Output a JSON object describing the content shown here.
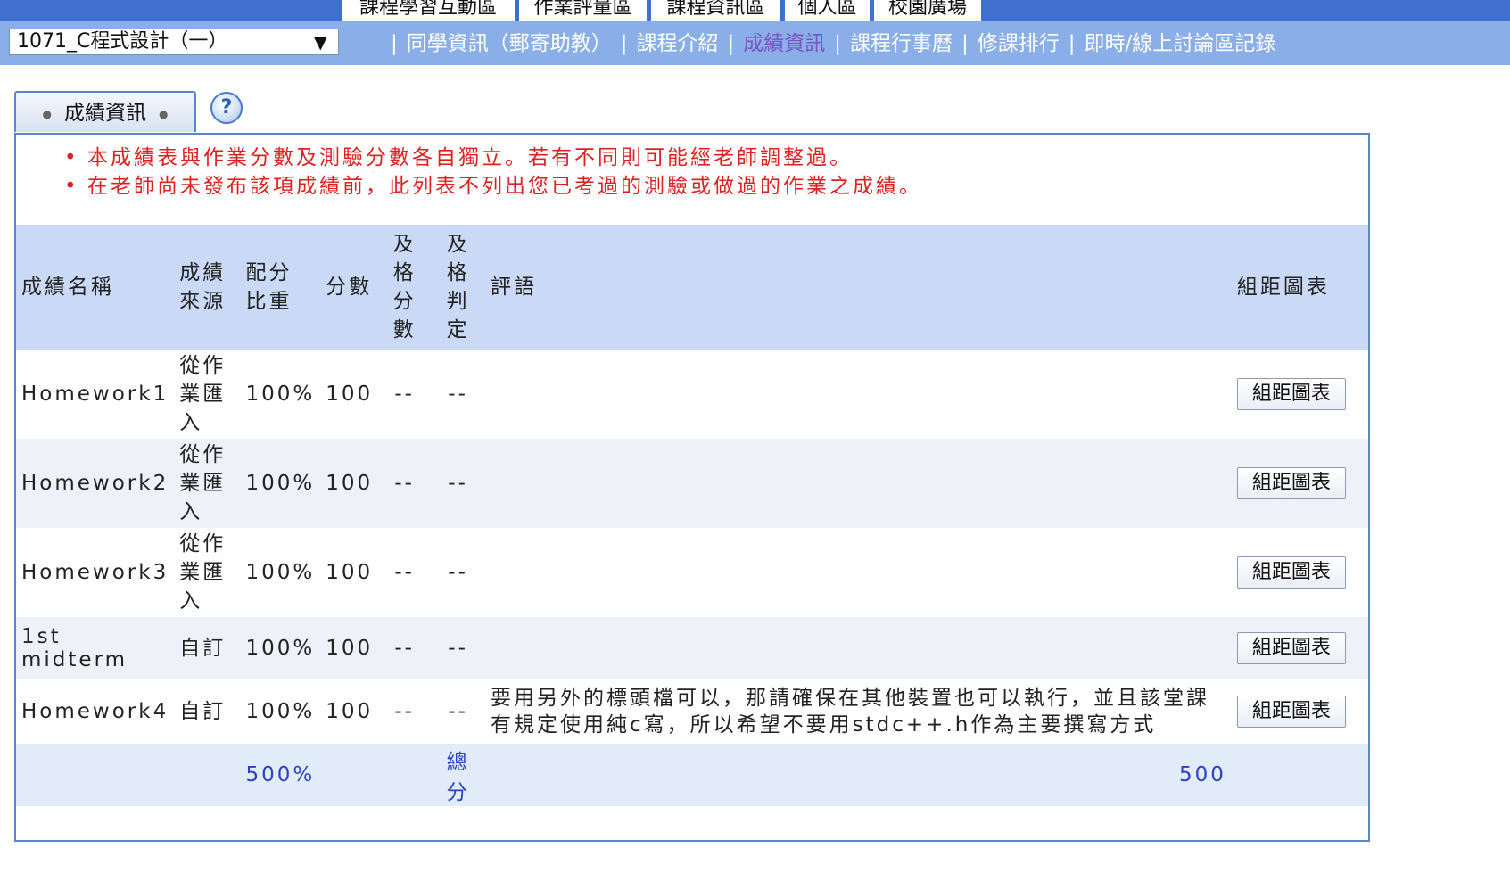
{
  "top_tabs": [
    {
      "label": "課程學習互動區"
    },
    {
      "label": "作業評量區"
    },
    {
      "label": "課程資訊區"
    },
    {
      "label": "個人區"
    },
    {
      "label": "校園廣場"
    }
  ],
  "course_select": {
    "value": "1071_C程式設計（一）"
  },
  "subnav": {
    "items": [
      {
        "label": "同學資訊（郵寄助教）"
      },
      {
        "label": "課程介紹"
      },
      {
        "label": "成績資訊"
      },
      {
        "label": "課程行事曆"
      },
      {
        "label": "修課排行"
      },
      {
        "label": "即時/線上討論區記錄"
      }
    ]
  },
  "section_tab": {
    "label": "成績資訊"
  },
  "help_icon": {
    "label": "?"
  },
  "notes": [
    "本成績表與作業分數及測驗分數各自獨立。若有不同則可能經老師調整過。",
    "在老師尚未發布該項成績前，此列表不列出您已考過的測驗或做過的作業之成績。"
  ],
  "table": {
    "headers": {
      "name": "成績名稱",
      "source": "成績來源",
      "weight": "配分比重",
      "score": "分數",
      "pass_score": "及格分數",
      "pass_judge": "及格判定",
      "comment": "評語",
      "chart": "組距圖表"
    },
    "rows": [
      {
        "name": "Homework1",
        "source": "從作業匯入",
        "weight": "100%",
        "score": "100",
        "pass_score": "--",
        "pass_judge": "--",
        "comment": "",
        "chart_btn": "組距圖表"
      },
      {
        "name": "Homework2",
        "source": "從作業匯入",
        "weight": "100%",
        "score": "100",
        "pass_score": "--",
        "pass_judge": "--",
        "comment": "",
        "chart_btn": "組距圖表"
      },
      {
        "name": "Homework3",
        "source": "從作業匯入",
        "weight": "100%",
        "score": "100",
        "pass_score": "--",
        "pass_judge": "--",
        "comment": "",
        "chart_btn": "組距圖表"
      },
      {
        "name": "1st midterm",
        "source": "自訂",
        "weight": "100%",
        "score": "100",
        "pass_score": "--",
        "pass_judge": "--",
        "comment": "",
        "chart_btn": "組距圖表"
      },
      {
        "name": "Homework4",
        "source": "自訂",
        "weight": "100%",
        "score": "100",
        "pass_score": "--",
        "pass_judge": "--",
        "comment": "要用另外的標頭檔可以，那請確保在其他裝置也可以執行，並且該堂課有規定使用純c寫，所以希望不要用stdc++.h作為主要撰寫方式",
        "chart_btn": "組距圖表"
      }
    ],
    "total": {
      "weight": "500%",
      "label": "總分",
      "total_score": "500"
    }
  }
}
